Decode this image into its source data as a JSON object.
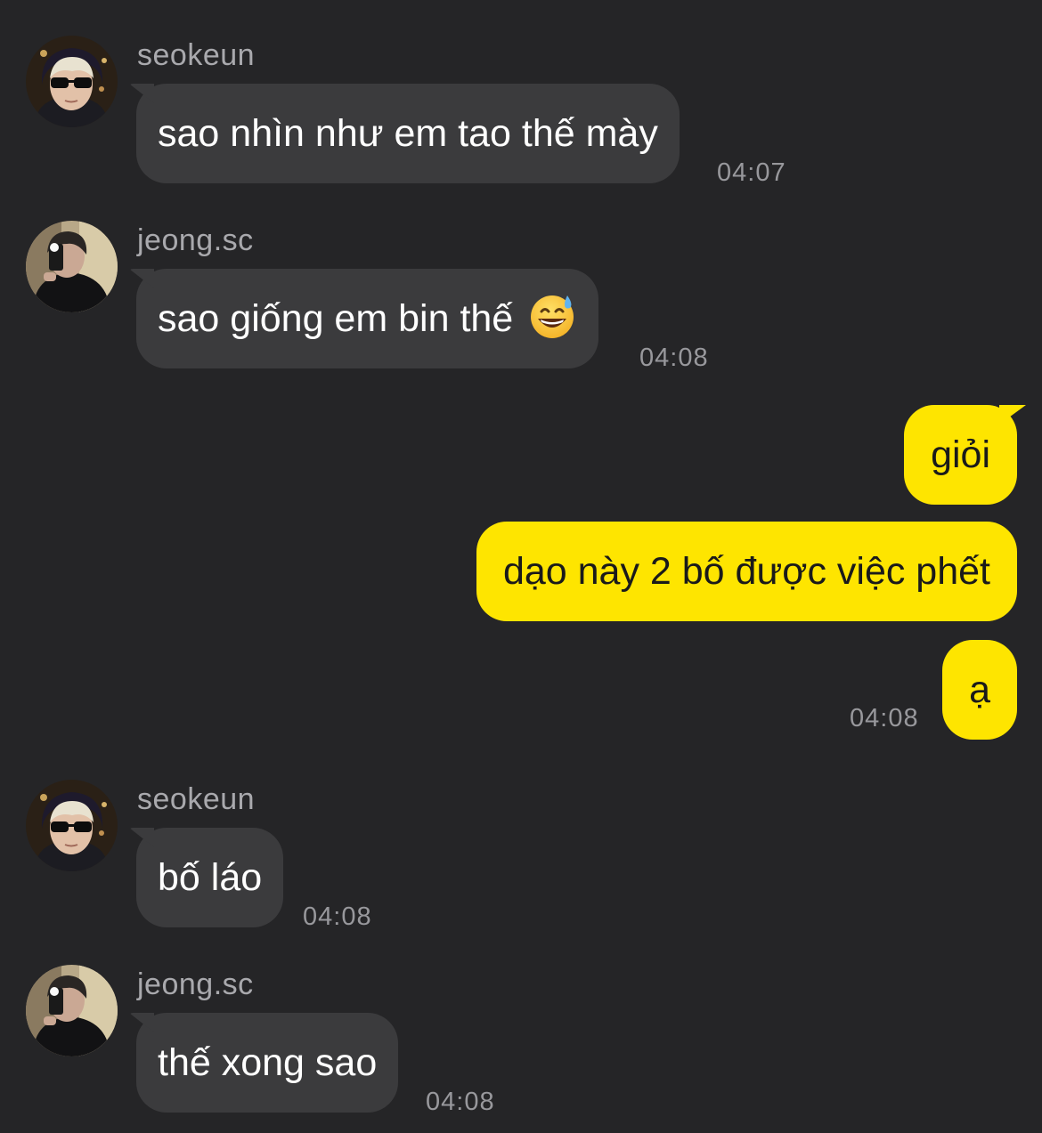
{
  "messages": [
    {
      "sender": "seokeun",
      "text": "sao nhìn như em tao thế mày",
      "time": "04:07"
    },
    {
      "sender": "jeong.sc",
      "text": "sao giống em bin thế",
      "emoji": "grinning-face-with-sweat-icon",
      "time": "04:08"
    },
    {
      "sender": "me",
      "text": "giỏi"
    },
    {
      "sender": "me",
      "text": "dạo này 2 bố được việc phết"
    },
    {
      "sender": "me",
      "text": "ạ",
      "time": "04:08"
    },
    {
      "sender": "seokeun",
      "text": "bố láo",
      "time": "04:08"
    },
    {
      "sender": "jeong.sc",
      "text": "thế xong sao",
      "time": "04:08"
    }
  ],
  "colors": {
    "background": "#252527",
    "incoming_bubble": "#3b3b3d",
    "outgoing_bubble": "#fee500",
    "sender_name": "#a9a9ad",
    "timestamp": "#98989c"
  }
}
